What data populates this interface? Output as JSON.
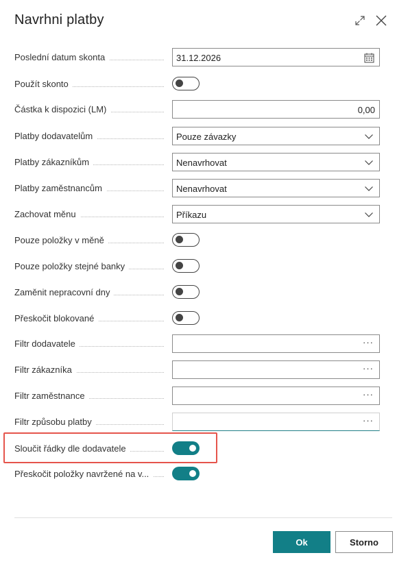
{
  "dialog": {
    "title": "Navrhni platby",
    "expand_icon": "expand-icon",
    "close_icon": "close-icon"
  },
  "fields": {
    "discount_date": {
      "label": "Poslední datum skonta",
      "value": "31.12.2026",
      "icon": "calendar-icon"
    },
    "use_discount": {
      "label": "Použít skonto",
      "on": false
    },
    "available_amount": {
      "label": "Částka k dispozici (LM)",
      "value": "0,00"
    },
    "vendor_payments": {
      "label": "Platby dodavatelům",
      "value": "Pouze závazky"
    },
    "customer_payments": {
      "label": "Platby zákazníkům",
      "value": "Nenavrhovat"
    },
    "employee_payments": {
      "label": "Platby zaměstnancům",
      "value": "Nenavrhovat"
    },
    "keep_currency": {
      "label": "Zachovat měnu",
      "value": "Příkazu"
    },
    "currency_only": {
      "label": "Pouze položky v měně",
      "on": false
    },
    "same_bank_only": {
      "label": "Pouze položky stejné banky",
      "on": false
    },
    "replace_nonworking": {
      "label": "Zaměnit nepracovní dny",
      "on": false
    },
    "skip_blocked": {
      "label": "Přeskočit blokované",
      "on": false
    },
    "vendor_filter": {
      "label": "Filtr dodavatele",
      "value": ""
    },
    "customer_filter": {
      "label": "Filtr zákazníka",
      "value": ""
    },
    "employee_filter": {
      "label": "Filtr zaměstnance",
      "value": ""
    },
    "payment_method_filter": {
      "label": "Filtr způsobu platby",
      "value": ""
    },
    "merge_lines": {
      "label": "Sloučit řádky dle dodavatele",
      "on": true
    },
    "skip_suggested": {
      "label": "Přeskočit položky navržené na v...",
      "on": true
    }
  },
  "lookup_dots": "···",
  "buttons": {
    "ok": "Ok",
    "cancel": "Storno"
  },
  "colors": {
    "accent": "#127f87",
    "highlight": "#e5544b"
  }
}
